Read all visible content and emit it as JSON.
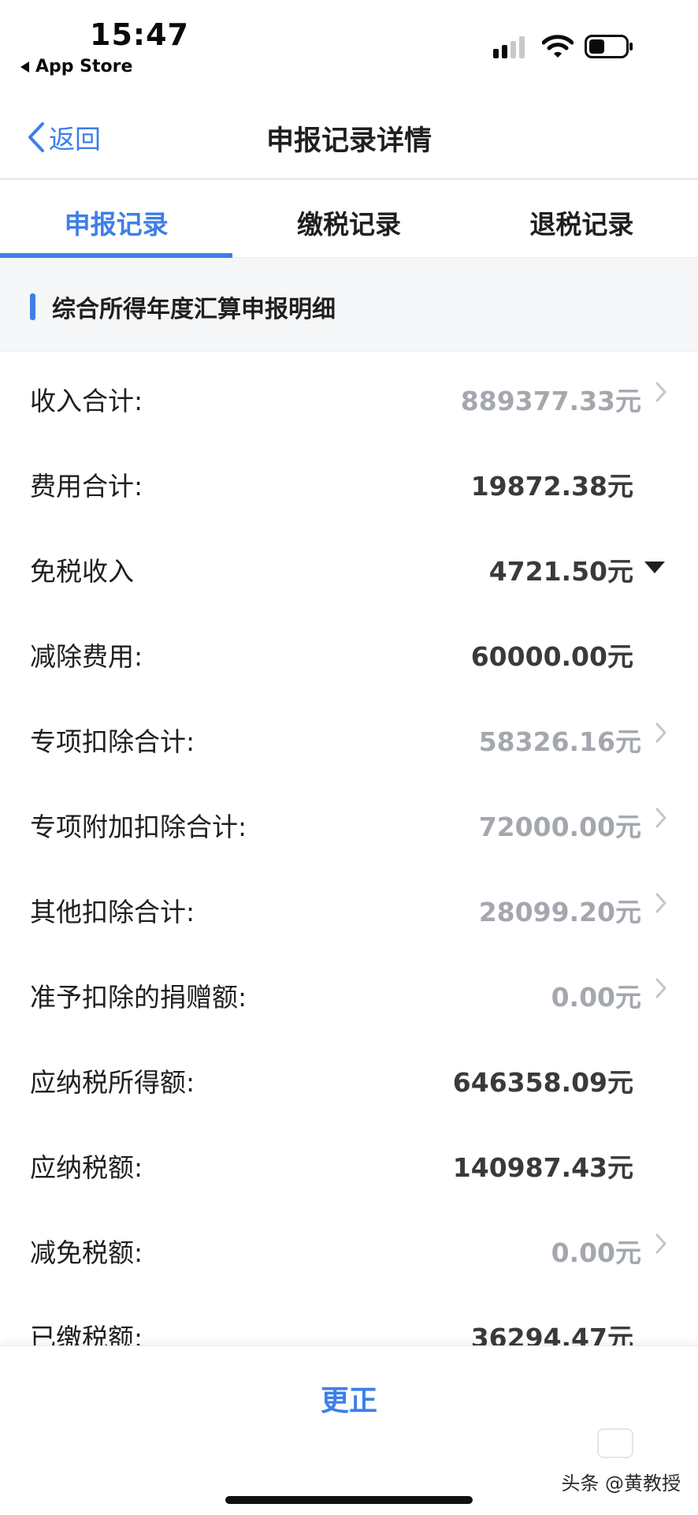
{
  "status_bar": {
    "time": "15:47",
    "back_app": "App Store",
    "icons": [
      "signal-icon",
      "wifi-icon",
      "battery-icon"
    ]
  },
  "nav": {
    "back_label": "返回",
    "title": "申报记录详情"
  },
  "tabs": [
    {
      "label": "申报记录",
      "active": true
    },
    {
      "label": "缴税记录",
      "active": false
    },
    {
      "label": "退税记录",
      "active": false
    }
  ],
  "section": {
    "title": "综合所得年度汇算申报明细"
  },
  "rows": [
    {
      "label": "收入合计:",
      "value": "889377.33元",
      "indicator": "chevron",
      "muted": true
    },
    {
      "label": "费用合计:",
      "value": "19872.38元",
      "indicator": "none",
      "muted": false
    },
    {
      "label": "免税收入",
      "value": "4721.50元",
      "indicator": "caret-down",
      "muted": false
    },
    {
      "label": "减除费用:",
      "value": "60000.00元",
      "indicator": "none",
      "muted": false
    },
    {
      "label": "专项扣除合计:",
      "value": "58326.16元",
      "indicator": "chevron",
      "muted": true
    },
    {
      "label": "专项附加扣除合计:",
      "value": "72000.00元",
      "indicator": "chevron",
      "muted": true
    },
    {
      "label": "其他扣除合计:",
      "value": "28099.20元",
      "indicator": "chevron",
      "muted": true
    },
    {
      "label": "准予扣除的捐赠额:",
      "value": "0.00元",
      "indicator": "chevron",
      "muted": true
    },
    {
      "label": "应纳税所得额:",
      "value": "646358.09元",
      "indicator": "none",
      "muted": false
    },
    {
      "label": "应纳税额:",
      "value": "140987.43元",
      "indicator": "none",
      "muted": false
    },
    {
      "label": "减免税额:",
      "value": "0.00元",
      "indicator": "chevron",
      "muted": true
    },
    {
      "label": "已缴税额:",
      "value": "36294.47元",
      "indicator": "none",
      "muted": false
    }
  ],
  "bottom": {
    "action_label": "更正",
    "watermark": "头条 @黄教授"
  },
  "colors": {
    "accent": "#3d7fe8",
    "muted_value": "#a4a8ae",
    "section_bg": "#f5f6f8"
  }
}
